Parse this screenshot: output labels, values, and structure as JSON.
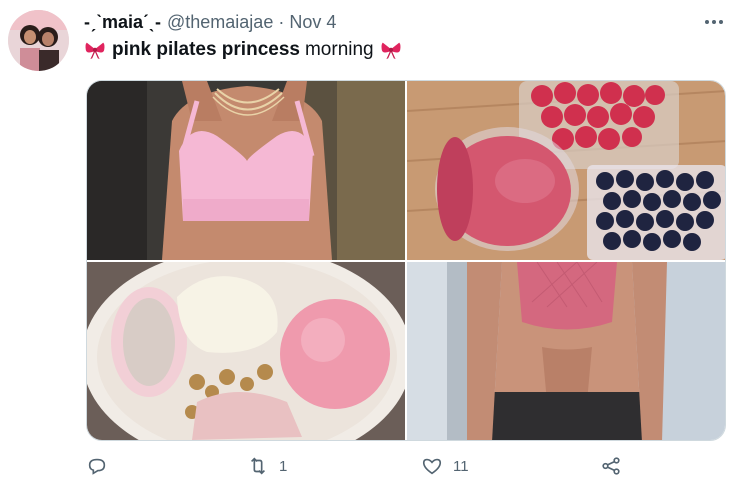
{
  "tweet": {
    "author": {
      "display_name": "-ˏˋmaiaˊˎ-",
      "handle": "@themaiajae",
      "separator": "·",
      "date": "Nov 4",
      "avatar_icon": "avatar-photo"
    },
    "text": {
      "leading_emoji": "ribbon-bow-icon",
      "bold": "pink pilates princess",
      "normal": "morning",
      "trailing_emoji": "ribbon-bow-icon"
    },
    "media": [
      {
        "name": "pink-sports-bra-photo"
      },
      {
        "name": "berry-smoothie-photo"
      },
      {
        "name": "mochi-ice-cream-photo"
      },
      {
        "name": "pink-workout-top-photo"
      }
    ],
    "actions": {
      "reply_count": "",
      "retweet_count": "1",
      "like_count": "11",
      "share_count": ""
    }
  },
  "colors": {
    "text": "#0f1419",
    "secondary": "#536471",
    "border": "#cfd9de",
    "bow": "#e0245e"
  }
}
